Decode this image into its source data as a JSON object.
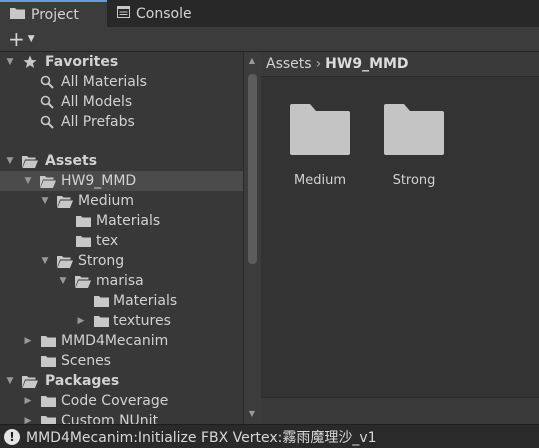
{
  "tabs": [
    {
      "label": "Project",
      "icon": "folder-icon",
      "active": true
    },
    {
      "label": "Console",
      "icon": "console-icon",
      "active": false
    }
  ],
  "toolbar": {
    "create_label": "+",
    "create_icon": "plus-icon"
  },
  "tree": {
    "favorites": {
      "label": "Favorites",
      "items": [
        "All Materials",
        "All Models",
        "All Prefabs"
      ]
    },
    "assets_label": "Assets",
    "hw9_label": "HW9_MMD",
    "medium_label": "Medium",
    "medium_materials": "Materials",
    "medium_tex": "tex",
    "strong_label": "Strong",
    "marisa_label": "marisa",
    "marisa_materials": "Materials",
    "marisa_textures": "textures",
    "mmd4mecanim": "MMD4Mecanim",
    "scenes": "Scenes",
    "packages_label": "Packages",
    "code_coverage": "Code Coverage",
    "custom_nunit": "Custom NUnit"
  },
  "breadcrumb": {
    "root": "Assets",
    "current": "HW9_MMD"
  },
  "grid": [
    {
      "label": "Medium"
    },
    {
      "label": "Strong"
    }
  ],
  "status": {
    "message": "MMD4Mecanim:Initialize FBX Vertex:霧雨魔理沙_v1"
  },
  "colors": {
    "background": "#383838",
    "tabbar": "#282828",
    "selected_row": "#4b4b4b",
    "folder": "#c4c4c4",
    "tab_accent": "#6a9be0"
  }
}
